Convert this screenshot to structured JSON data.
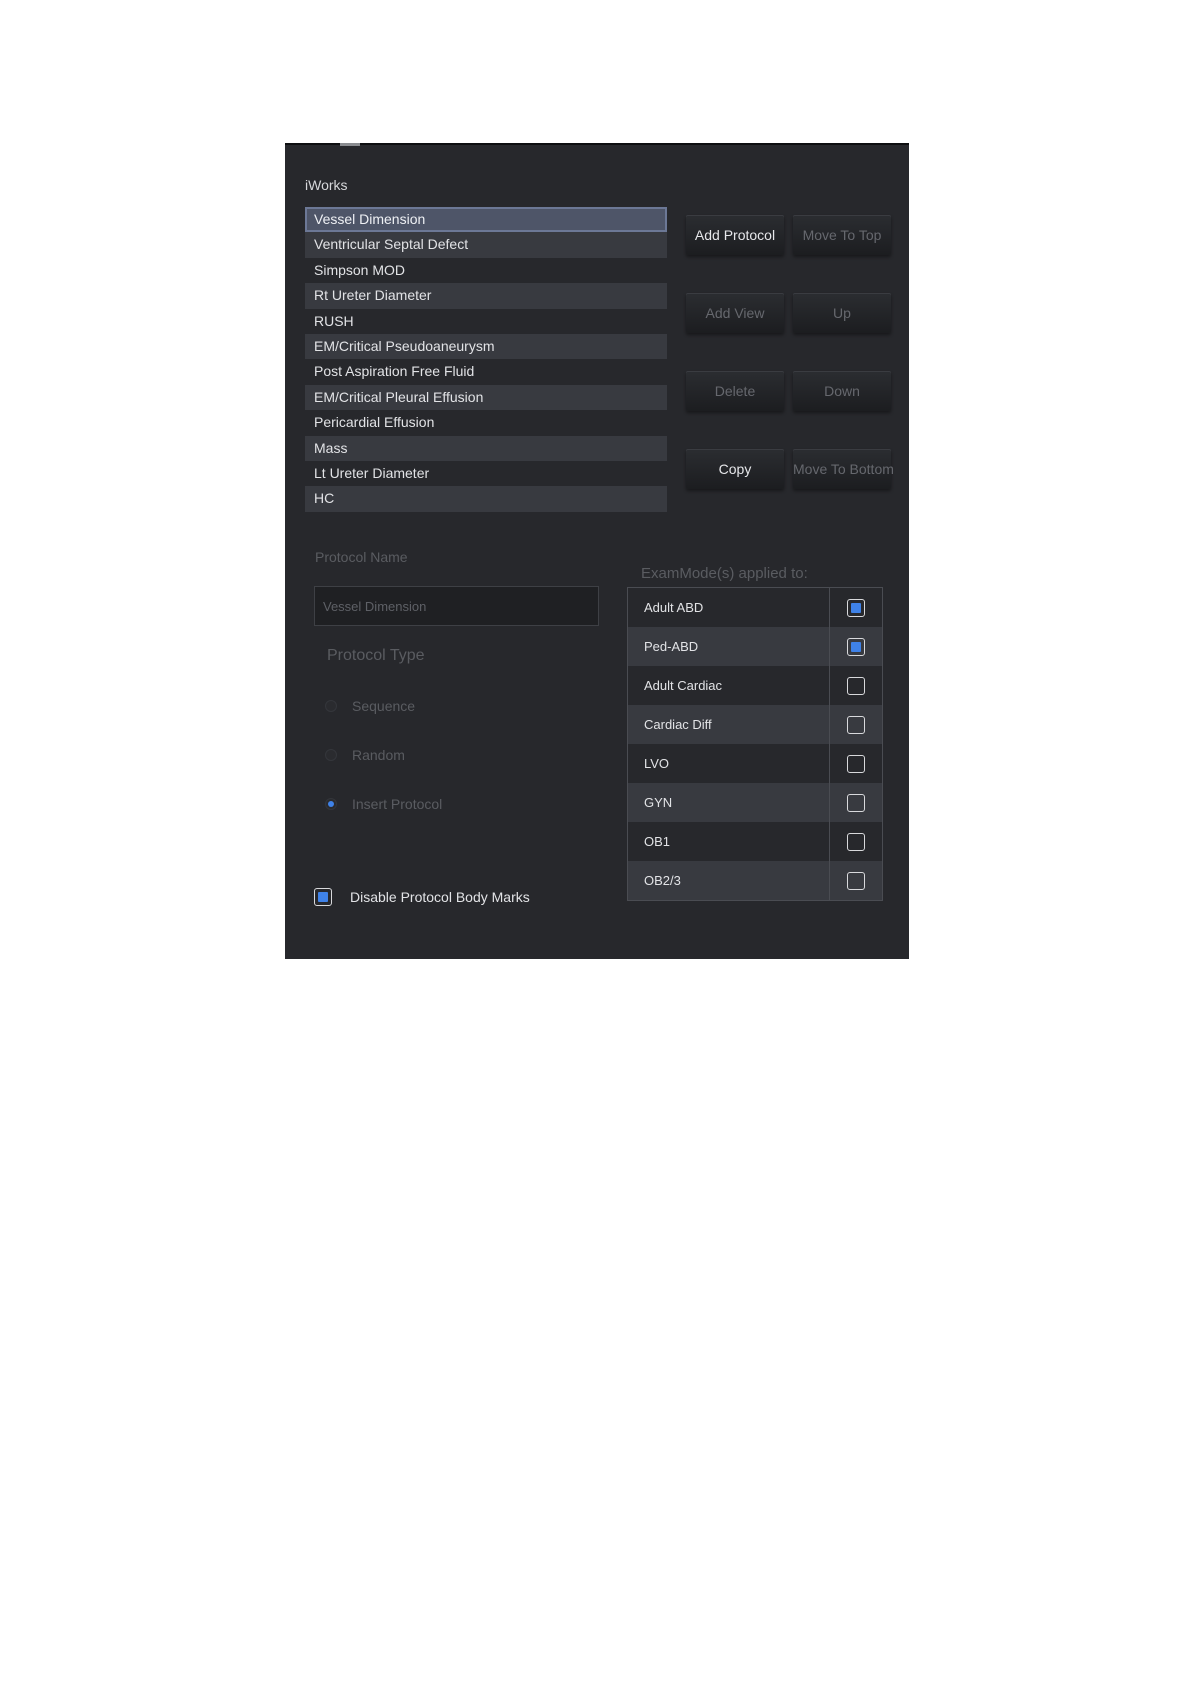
{
  "app": {
    "title": "iWorks"
  },
  "protocols": [
    {
      "label": "Vessel Dimension",
      "selected": true
    },
    {
      "label": "Ventricular Septal Defect"
    },
    {
      "label": "Simpson MOD"
    },
    {
      "label": "Rt Ureter Diameter"
    },
    {
      "label": "RUSH"
    },
    {
      "label": "EM/Critical Pseudoaneurysm"
    },
    {
      "label": "Post Aspiration Free Fluid"
    },
    {
      "label": "EM/Critical Pleural Effusion"
    },
    {
      "label": "Pericardial Effusion"
    },
    {
      "label": "Mass"
    },
    {
      "label": "Lt Ureter Diameter"
    },
    {
      "label": "HC"
    }
  ],
  "buttons": {
    "add_protocol": {
      "label": "Add Protocol",
      "enabled": true
    },
    "move_to_top": {
      "label": "Move To Top",
      "enabled": false
    },
    "add_view": {
      "label": "Add View",
      "enabled": false
    },
    "up": {
      "label": "Up",
      "enabled": false
    },
    "delete": {
      "label": "Delete",
      "enabled": false
    },
    "down": {
      "label": "Down",
      "enabled": false
    },
    "copy": {
      "label": "Copy",
      "enabled": true
    },
    "move_to_bottom": {
      "label": "Move To Bottom",
      "enabled": false
    }
  },
  "protocol_name": {
    "label": "Protocol Name",
    "value": "Vessel Dimension"
  },
  "protocol_type": {
    "label": "Protocol Type",
    "options": [
      {
        "label": "Sequence",
        "checked": false
      },
      {
        "label": "Random",
        "checked": false
      },
      {
        "label": "Insert Protocol",
        "checked": true
      }
    ]
  },
  "disable_body_marks": {
    "label": "Disable Protocol Body Marks",
    "checked": true
  },
  "exam_modes": {
    "title": "ExamMode(s) applied to:",
    "rows": [
      {
        "label": "Adult ABD",
        "checked": true
      },
      {
        "label": "Ped-ABD",
        "checked": true
      },
      {
        "label": "Adult Cardiac",
        "checked": false
      },
      {
        "label": "Cardiac Diff",
        "checked": false
      },
      {
        "label": "LVO",
        "checked": false
      },
      {
        "label": "GYN",
        "checked": false
      },
      {
        "label": "OB1",
        "checked": false
      },
      {
        "label": "OB2/3",
        "checked": false
      }
    ]
  },
  "colors": {
    "panel_bg": "#27282c",
    "row_alt_bg": "#383a40",
    "selection_bg": "#4e5568",
    "accent": "#3f82e8",
    "disabled_text": "#66686e"
  }
}
